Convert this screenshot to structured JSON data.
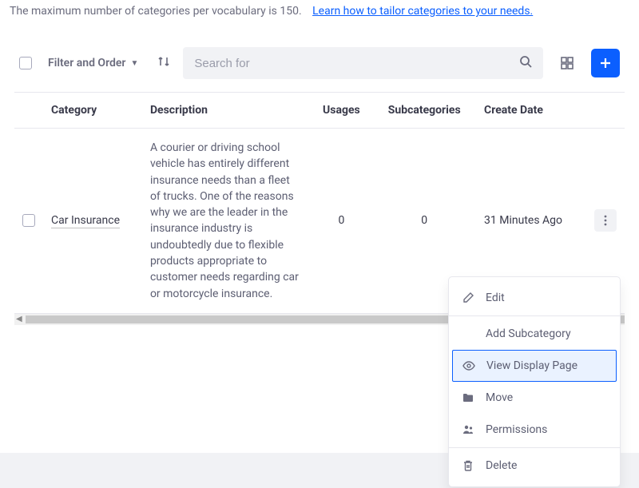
{
  "notice": {
    "text": "The maximum number of categories per vocabulary is 150.",
    "link": "Learn how to tailor categories to your needs."
  },
  "toolbar": {
    "filter_label": "Filter and Order",
    "search_placeholder": "Search for"
  },
  "table": {
    "headers": {
      "category": "Category",
      "description": "Description",
      "usages": "Usages",
      "subcategories": "Subcategories",
      "create_date": "Create Date"
    },
    "rows": [
      {
        "category": "Car Insurance",
        "description": "A courier or driving school vehicle has entirely different insurance needs than a fleet of trucks. One of the reasons why we are the leader in the insurance industry is undoubtedly due to flexible products appropriate to customer needs regarding car or motorcycle insurance.",
        "usages": "0",
        "subcategories": "0",
        "create_date": "31 Minutes Ago"
      }
    ]
  },
  "menu": {
    "edit": "Edit",
    "add_sub": "Add Subcategory",
    "view_display": "View Display Page",
    "move": "Move",
    "permissions": "Permissions",
    "delete": "Delete"
  }
}
